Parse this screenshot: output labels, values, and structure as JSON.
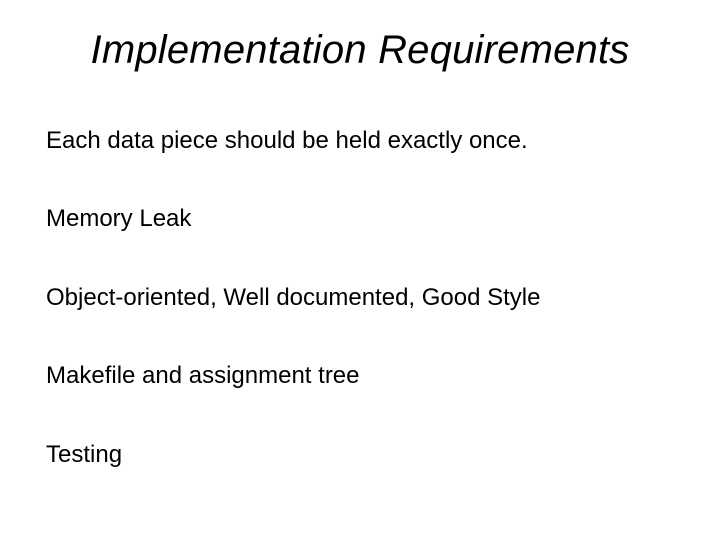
{
  "slide": {
    "title": "Implementation Requirements",
    "bullets": [
      "Each data piece should be held exactly once.",
      "Memory Leak",
      "Object-oriented, Well documented, Good Style",
      "Makefile and assignment tree",
      "Testing"
    ]
  }
}
